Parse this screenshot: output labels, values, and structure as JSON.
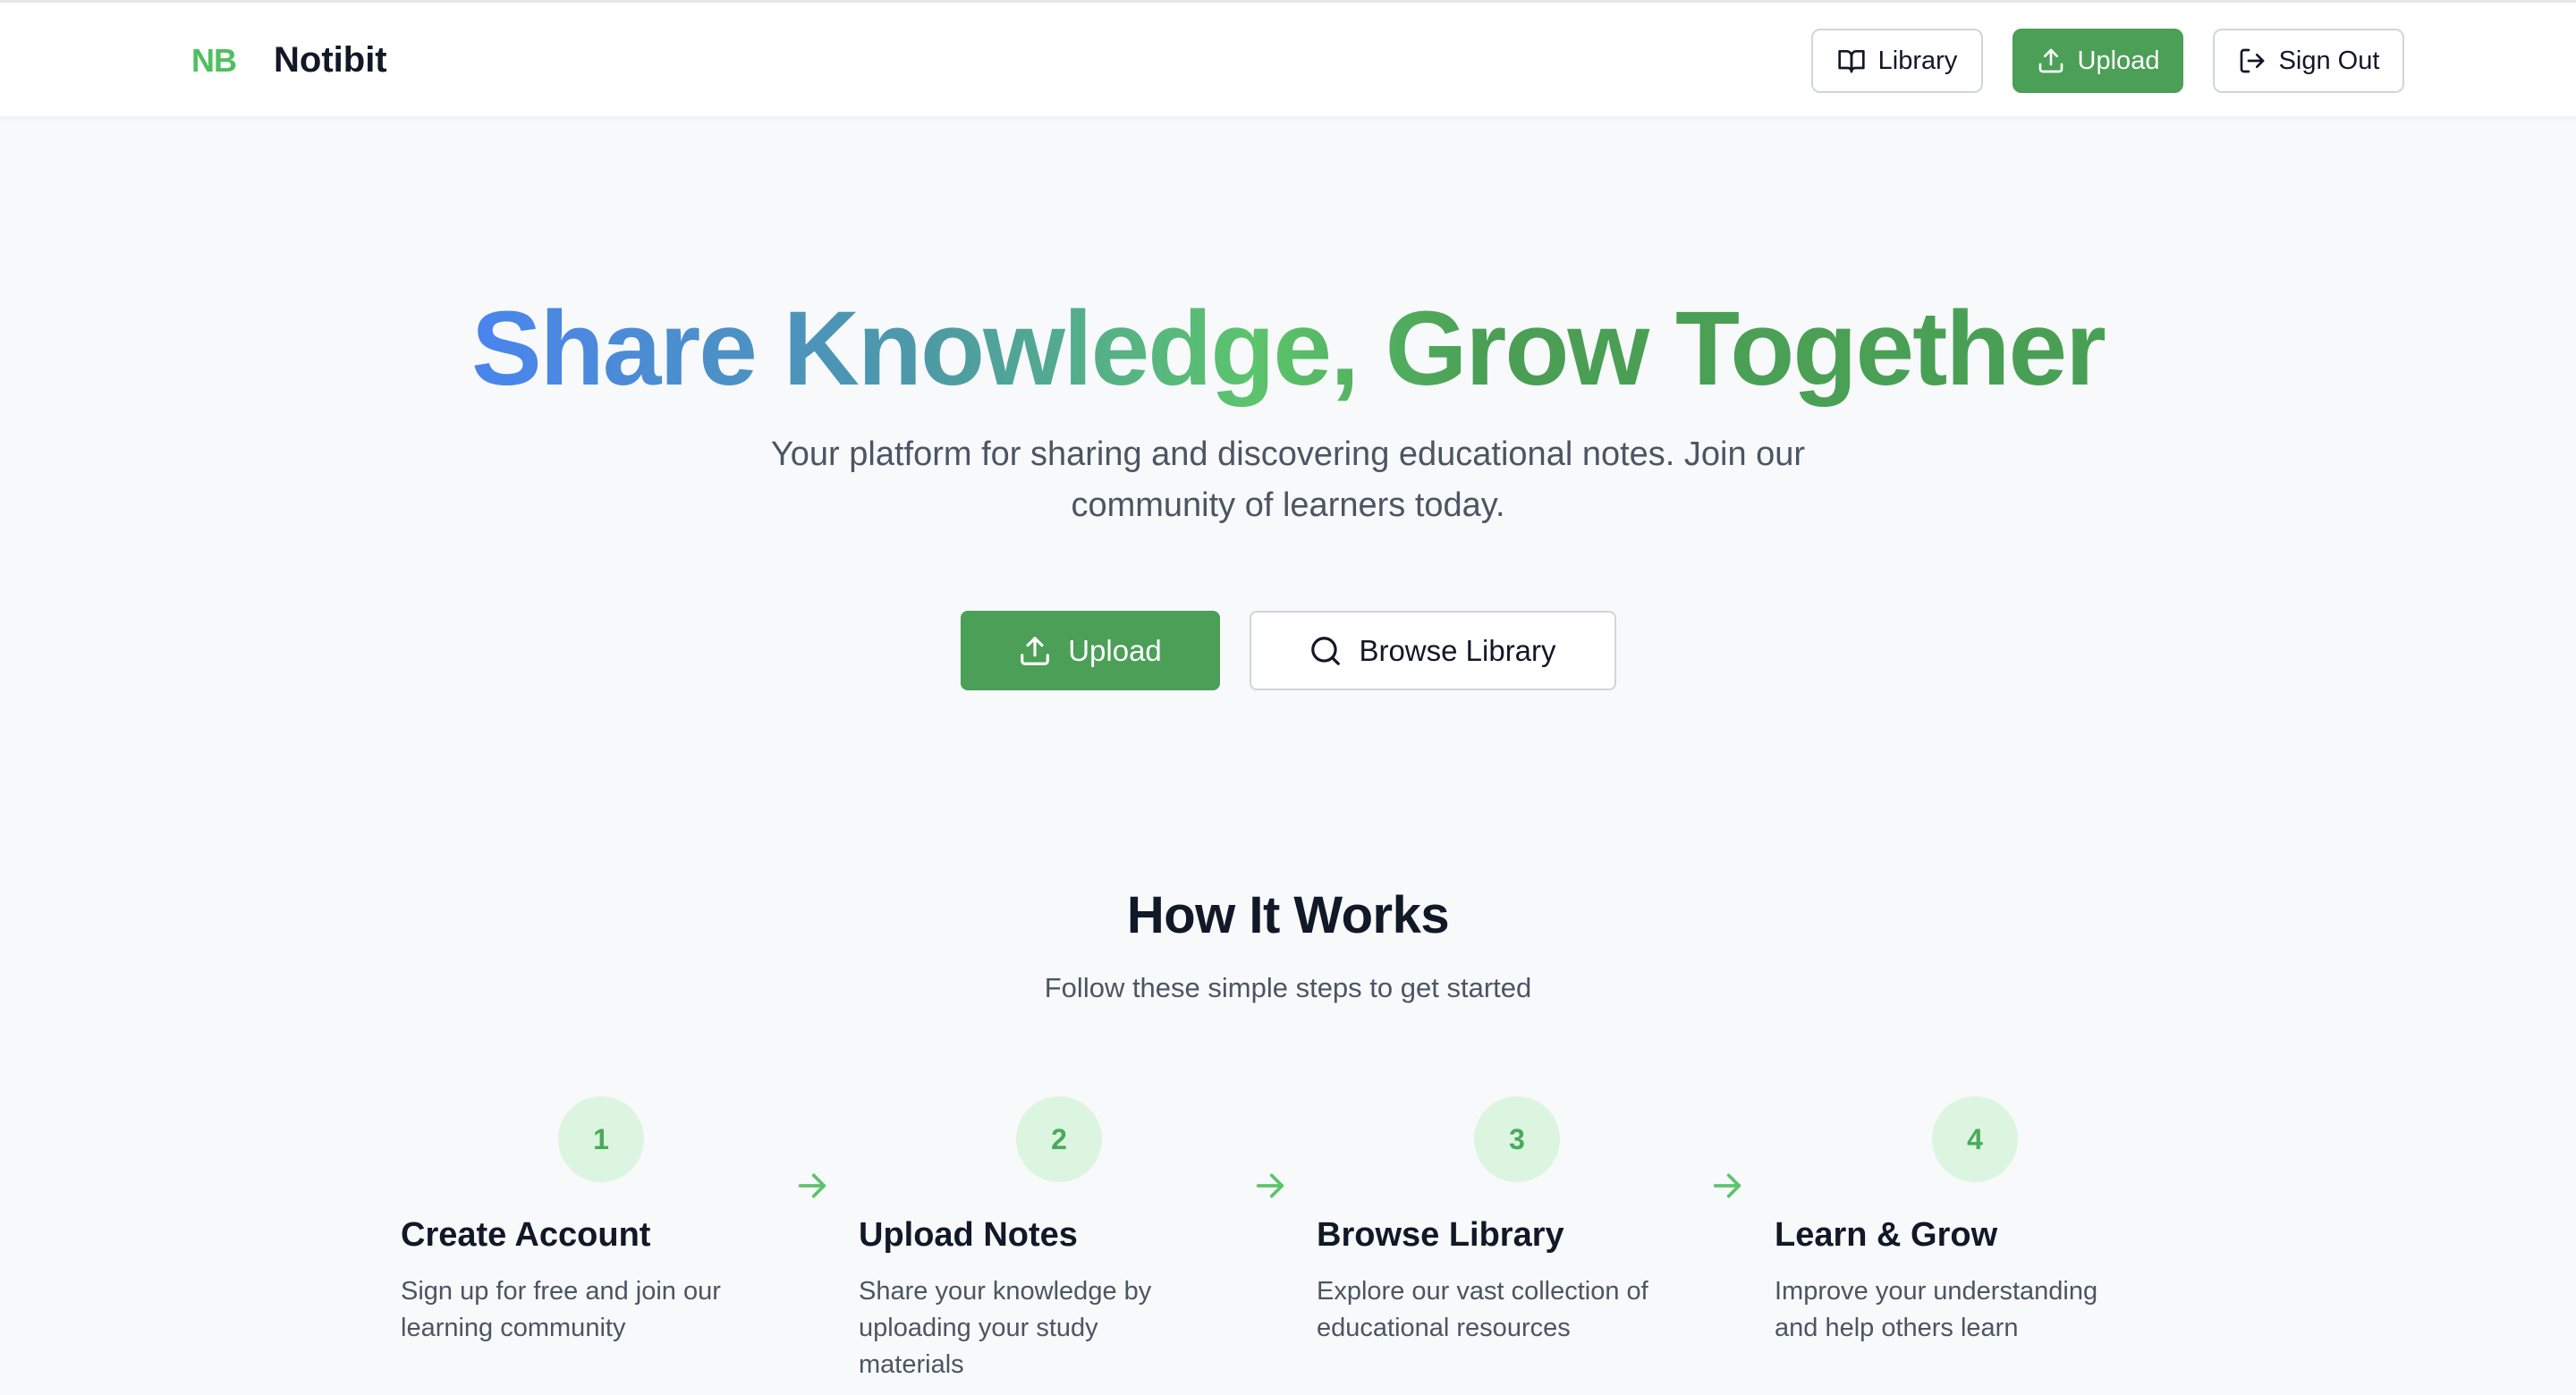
{
  "header": {
    "logo_mark": "NB",
    "brand_name": "Notibit",
    "nav": {
      "library_label": "Library",
      "upload_label": "Upload",
      "sign_out_label": "Sign Out"
    }
  },
  "hero": {
    "title": "Share Knowledge, Grow Together",
    "subtitle": "Your platform for sharing and discovering educational notes. Join our community of learners today.",
    "upload_label": "Upload",
    "browse_label": "Browse Library"
  },
  "how_it_works": {
    "title": "How It Works",
    "subtitle": "Follow these simple steps to get started",
    "steps": [
      {
        "number": "1",
        "title": "Create Account",
        "description": "Sign up for free and join our learning community"
      },
      {
        "number": "2",
        "title": "Upload Notes",
        "description": "Share your knowledge by uploading your study materials"
      },
      {
        "number": "3",
        "title": "Browse Library",
        "description": "Explore our vast collection of educational resources"
      },
      {
        "number": "4",
        "title": "Learn & Grow",
        "description": "Improve your understanding and help others learn"
      }
    ]
  },
  "colors": {
    "brand_green": "#4b9f56",
    "logo_green": "#4fbf5f",
    "gradient_start": "#4a84ef",
    "step_circle": "#dcf5e0"
  },
  "icons": {
    "library": "book-open-icon",
    "upload": "upload-icon",
    "sign_out": "log-out-icon",
    "browse": "search-icon",
    "step_connector": "arrow-right-icon"
  }
}
